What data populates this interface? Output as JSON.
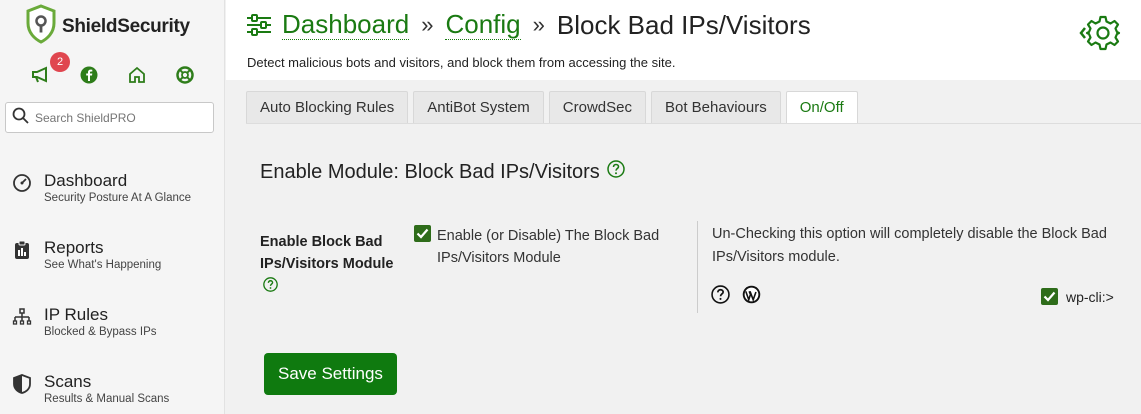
{
  "brand": {
    "name": "ShieldSecurity"
  },
  "quick_links": {
    "badge_count": "2"
  },
  "search": {
    "placeholder": "Search ShieldPRO"
  },
  "nav": [
    {
      "title": "Dashboard",
      "subtitle": "Security Posture At A Glance"
    },
    {
      "title": "Reports",
      "subtitle": "See What's Happening"
    },
    {
      "title": "IP Rules",
      "subtitle": "Blocked & Bypass IPs"
    },
    {
      "title": "Scans",
      "subtitle": "Results & Manual Scans"
    }
  ],
  "breadcrumb": {
    "level1": "Dashboard",
    "level2": "Config",
    "current": "Block Bad IPs/Visitors",
    "separator": "»"
  },
  "page": {
    "subtitle": "Detect malicious bots and visitors, and block them from accessing the site."
  },
  "tabs": [
    "Auto Blocking Rules",
    "AntiBot System",
    "CrowdSec",
    "Bot Behaviours",
    "On/Off"
  ],
  "active_tab": "On/Off",
  "section": {
    "title": "Enable Module: Block Bad IPs/Visitors"
  },
  "option": {
    "label": "Enable Block Bad IPs/Visitors Module",
    "checkbox_label": "Enable (or Disable) The Block Bad IPs/Visitors Module",
    "checked": true,
    "description": "Un-Checking this option will completely disable the Block Bad IPs/Visitors module.",
    "wpcli_label": "wp-cli:>",
    "wpcli_checked": true
  },
  "save_button": "Save Settings",
  "colors": {
    "brand_green": "#1a7a12",
    "button_green": "#0f7a0f",
    "badge_red": "#e0464f",
    "checkbox_green": "#2e6c1a"
  }
}
